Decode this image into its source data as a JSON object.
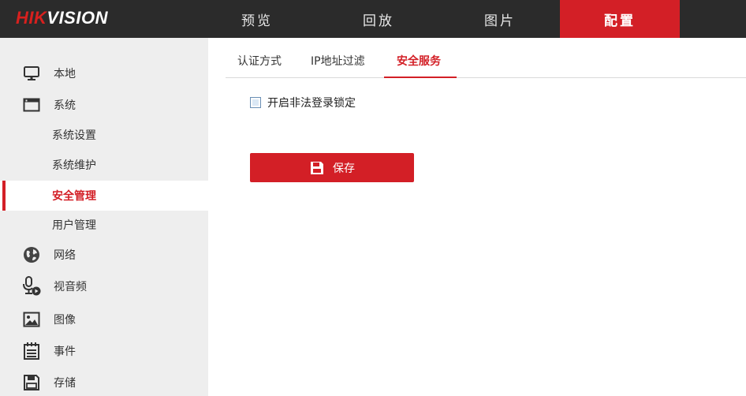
{
  "brand": {
    "logo_hik": "HIK",
    "logo_vision": "VISION",
    "accent": "#d31f26"
  },
  "nav": {
    "preview": "预览",
    "playback": "回放",
    "picture": "图片",
    "config": "配置"
  },
  "sidebar": {
    "local": "本地",
    "system": "系统",
    "system_settings": "系统设置",
    "system_maintenance": "系统维护",
    "security_management": "安全管理",
    "user_management": "用户管理",
    "network": "网络",
    "video_audio": "视音频",
    "image": "图像",
    "event": "事件",
    "storage": "存储"
  },
  "tabs": {
    "authentication": "认证方式",
    "ip_filter": "IP地址过滤",
    "security_service": "安全服务"
  },
  "form": {
    "illegal_login_lock_label": "开启非法登录锁定",
    "illegal_login_lock_checked": false
  },
  "actions": {
    "save_label": "保存"
  }
}
